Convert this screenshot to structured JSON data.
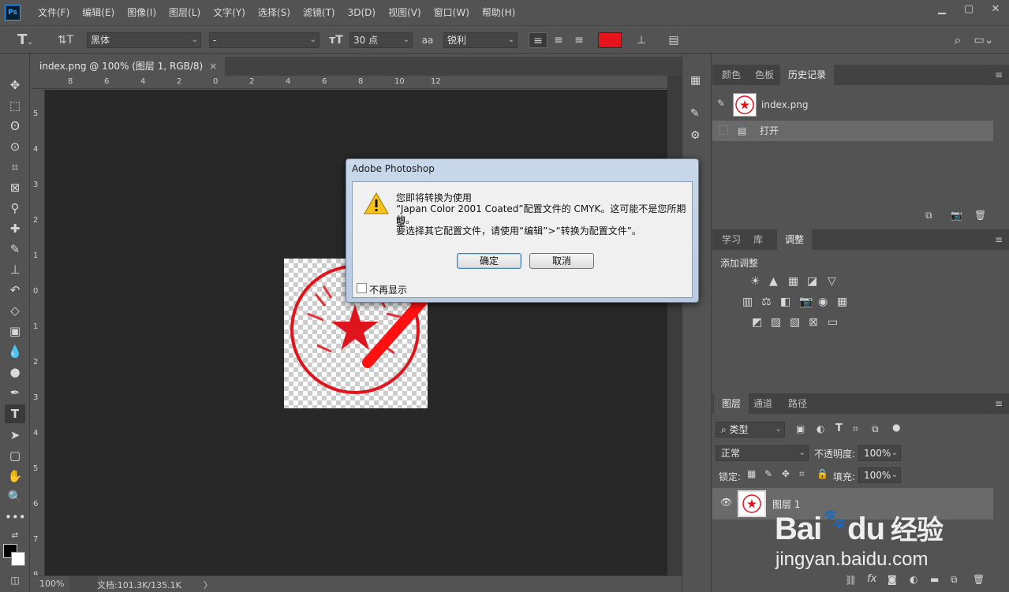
{
  "app": {
    "logo": "Ps"
  },
  "menu": [
    "文件(F)",
    "编辑(E)",
    "图像(I)",
    "图层(L)",
    "文字(Y)",
    "选择(S)",
    "滤镜(T)",
    "3D(D)",
    "视图(V)",
    "窗口(W)",
    "帮助(H)"
  ],
  "options": {
    "font_family": "黑体",
    "font_style": "-",
    "font_size": "30 点",
    "aa_label": "aa",
    "antialias": "锐利",
    "color": "#e8141c"
  },
  "document": {
    "tab_title": "index.png @ 100% (图层 1, RGB/8)",
    "close": "×",
    "zoom": "100%",
    "doc_info": "文档:101.3K/135.1K",
    "nav_arrow": "〉"
  },
  "ruler_h": [
    "8",
    "6",
    "4",
    "2",
    "0",
    "2",
    "4",
    "6",
    "8",
    "10",
    "12"
  ],
  "ruler_v": [
    "5",
    "4",
    "3",
    "2",
    "1",
    "0",
    "1",
    "2",
    "3",
    "4",
    "5",
    "6",
    "7",
    "8"
  ],
  "history_panel": {
    "tabs": [
      "颜色",
      "色板",
      "历史记录"
    ],
    "active_tab": "历史记录",
    "snapshot": "index.png",
    "step": "打开"
  },
  "adjust_panel": {
    "tabs": [
      "学习",
      "库",
      "调整"
    ],
    "active_tab": "调整",
    "title": "添加调整"
  },
  "layers_panel": {
    "tabs": [
      "图层",
      "通道",
      "路径"
    ],
    "active_tab": "图层",
    "filter_label": "类型",
    "blend_mode": "正常",
    "opacity_label": "不透明度:",
    "opacity": "100%",
    "lock_label": "锁定:",
    "fill_label": "填充:",
    "fill": "100%",
    "layer_name": "图层 1",
    "footer_fx": "fx"
  },
  "dialog": {
    "title": "Adobe Photoshop",
    "message_line1": "您即将转换为使用",
    "message_line2": "“Japan Color 2001 Coated”配置文件的 CMYK。这可能不是您所期望",
    "message_line3": "的。",
    "message_line4": "要选择其它配置文件，请使用“编辑”>“转换为配置文件”。",
    "ok": "确定",
    "cancel": "取消",
    "dont_show": "不再显示"
  },
  "watermark": {
    "brand": "Bai",
    "du": "du",
    "cn": "经验",
    "url": "jingyan.baidu.com"
  }
}
